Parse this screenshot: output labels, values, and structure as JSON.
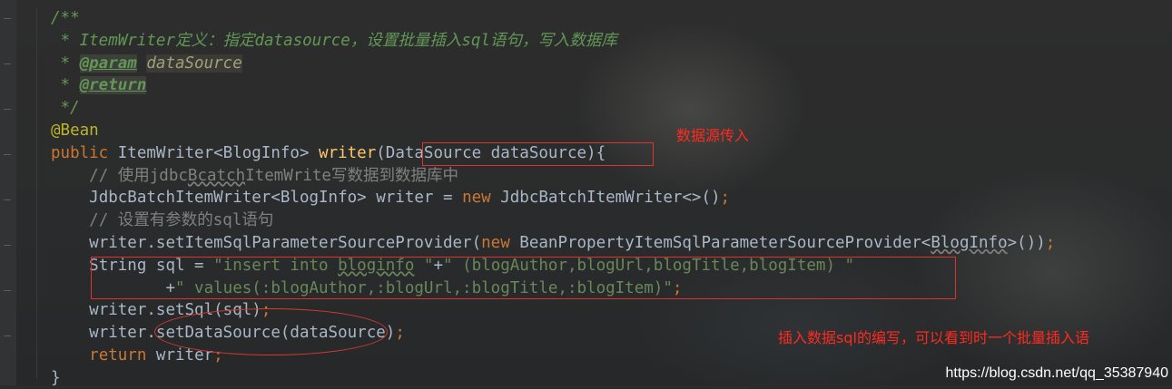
{
  "code_lines": [
    {
      "indent": "",
      "tokens": [
        {
          "t": "/**",
          "c": "c-doc"
        }
      ]
    },
    {
      "indent": "",
      "tokens": [
        {
          "t": " * ItemWriter定义：指定datasource，设置批量插入sql语句，写入数据库",
          "c": "c-doc"
        }
      ]
    },
    {
      "indent": "",
      "tokens": [
        {
          "t": " * ",
          "c": "c-doc"
        },
        {
          "t": "@param",
          "c": "c-tag"
        },
        {
          "t": " ",
          "c": "c-doc"
        },
        {
          "t": "dataSource",
          "c": "c-param"
        }
      ]
    },
    {
      "indent": "",
      "tokens": [
        {
          "t": " * ",
          "c": "c-doc"
        },
        {
          "t": "@return",
          "c": "c-tag"
        }
      ]
    },
    {
      "indent": "",
      "tokens": [
        {
          "t": " */",
          "c": "c-doc"
        }
      ]
    },
    {
      "indent": "",
      "tokens": [
        {
          "t": "@Bean",
          "c": "c-ann"
        }
      ]
    },
    {
      "indent": "",
      "tokens": [
        {
          "t": "public ",
          "c": "c-kw"
        },
        {
          "t": "ItemWriter<BlogInfo> ",
          "c": "c-plain"
        },
        {
          "t": "writer",
          "c": "c-fn"
        },
        {
          "t": "(DataSource dataSource){",
          "c": "c-plain"
        }
      ]
    },
    {
      "indent": "    ",
      "tokens": [
        {
          "t": "// 使用jdbc",
          "c": "c-cmt"
        },
        {
          "t": "Bcatch",
          "c": "c-cmt c-sq2"
        },
        {
          "t": "ItemWrite写数据到数据库中",
          "c": "c-cmt"
        }
      ]
    },
    {
      "indent": "    ",
      "tokens": [
        {
          "t": "JdbcBatchItemWriter<BlogInfo> writer = ",
          "c": "c-plain"
        },
        {
          "t": "new ",
          "c": "c-kw"
        },
        {
          "t": "JdbcBatchItemWriter<>()",
          "c": "c-plain"
        },
        {
          "t": ";",
          "c": "c-kw"
        }
      ]
    },
    {
      "indent": "    ",
      "tokens": [
        {
          "t": "// 设置有参数的sql语句",
          "c": "c-cmt"
        }
      ]
    },
    {
      "indent": "    ",
      "tokens": [
        {
          "t": "writer.setItemSqlParameterSourceProvider(",
          "c": "c-plain"
        },
        {
          "t": "new ",
          "c": "c-kw"
        },
        {
          "t": "BeanPropertyItemSqlParameterSourceProvider<",
          "c": "c-plain"
        },
        {
          "t": "BlogInfo",
          "c": "c-plain c-sq2"
        },
        {
          "t": ">())",
          "c": "c-plain"
        },
        {
          "t": ";",
          "c": "c-kw"
        }
      ]
    },
    {
      "indent": "    ",
      "tokens": [
        {
          "t": "String sql = ",
          "c": "c-plain"
        },
        {
          "t": "\"insert into ",
          "c": "c-str"
        },
        {
          "t": "bloginfo",
          "c": "c-str c-sq"
        },
        {
          "t": " \"",
          "c": "c-str"
        },
        {
          "t": "+",
          "c": "c-plain"
        },
        {
          "t": "\" (blogAuthor,blogUrl,blogTitle,blogItem) \"",
          "c": "c-str"
        }
      ]
    },
    {
      "indent": "            ",
      "tokens": [
        {
          "t": "+",
          "c": "c-plain"
        },
        {
          "t": "\" values(:blogAuthor,:blogUrl,:blogTitle,:blogItem)\"",
          "c": "c-str"
        },
        {
          "t": ";",
          "c": "c-kw"
        }
      ]
    },
    {
      "indent": "    ",
      "tokens": [
        {
          "t": "writer.setSql(sql)",
          "c": "c-plain"
        },
        {
          "t": ";",
          "c": "c-kw"
        }
      ]
    },
    {
      "indent": "    ",
      "tokens": [
        {
          "t": "writer.setDataSource(dataSource)",
          "c": "c-plain"
        },
        {
          "t": ";",
          "c": "c-kw"
        }
      ]
    },
    {
      "indent": "    ",
      "tokens": [
        {
          "t": "return ",
          "c": "c-kw"
        },
        {
          "t": "writer",
          "c": "c-plain"
        },
        {
          "t": ";",
          "c": "c-kw"
        }
      ]
    },
    {
      "indent": "",
      "tokens": [
        {
          "t": "}",
          "c": "c-plain"
        }
      ]
    }
  ],
  "annotations": {
    "datasource_note": "数据源传入",
    "sql_note": "插入数据sql的编写，可以看到时一个批量插入语"
  },
  "watermark": "https://blog.csdn.net/qq_35387940",
  "colors": {
    "annotation_red": "#ff2a1f",
    "editor_bg": "#2b2b2b"
  }
}
